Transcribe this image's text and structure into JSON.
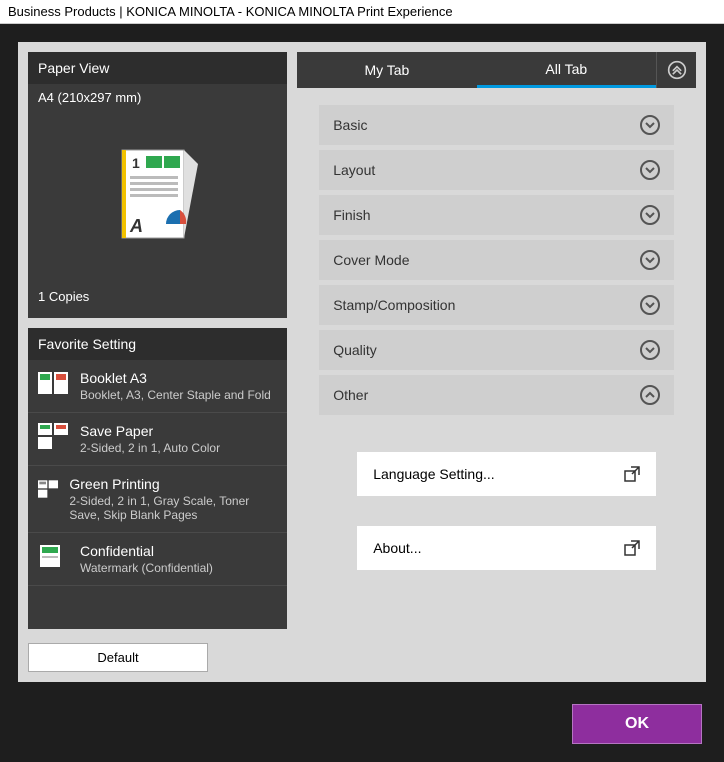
{
  "window": {
    "title": "Business Products | KONICA MINOLTA - KONICA MINOLTA Print Experience"
  },
  "paper_view": {
    "header": "Paper View",
    "size": "A4 (210x297 mm)",
    "copies": "1 Copies"
  },
  "favorites": {
    "header": "Favorite Setting",
    "items": [
      {
        "title": "Booklet A3",
        "desc": "Booklet, A3, Center Staple and Fold"
      },
      {
        "title": "Save Paper",
        "desc": "2-Sided, 2 in 1, Auto Color"
      },
      {
        "title": "Green Printing",
        "desc": "2-Sided, 2 in 1, Gray Scale, Toner Save, Skip Blank Pages"
      },
      {
        "title": "Confidential",
        "desc": "Watermark (Confidential)"
      }
    ]
  },
  "default_btn": "Default",
  "tabs": {
    "my": "My Tab",
    "all": "All Tab"
  },
  "sections": {
    "basic": "Basic",
    "layout": "Layout",
    "finish": "Finish",
    "cover": "Cover Mode",
    "stamp": "Stamp/Composition",
    "quality": "Quality",
    "other": "Other"
  },
  "other_items": {
    "language": "Language Setting...",
    "about": "About..."
  },
  "ok": "OK"
}
